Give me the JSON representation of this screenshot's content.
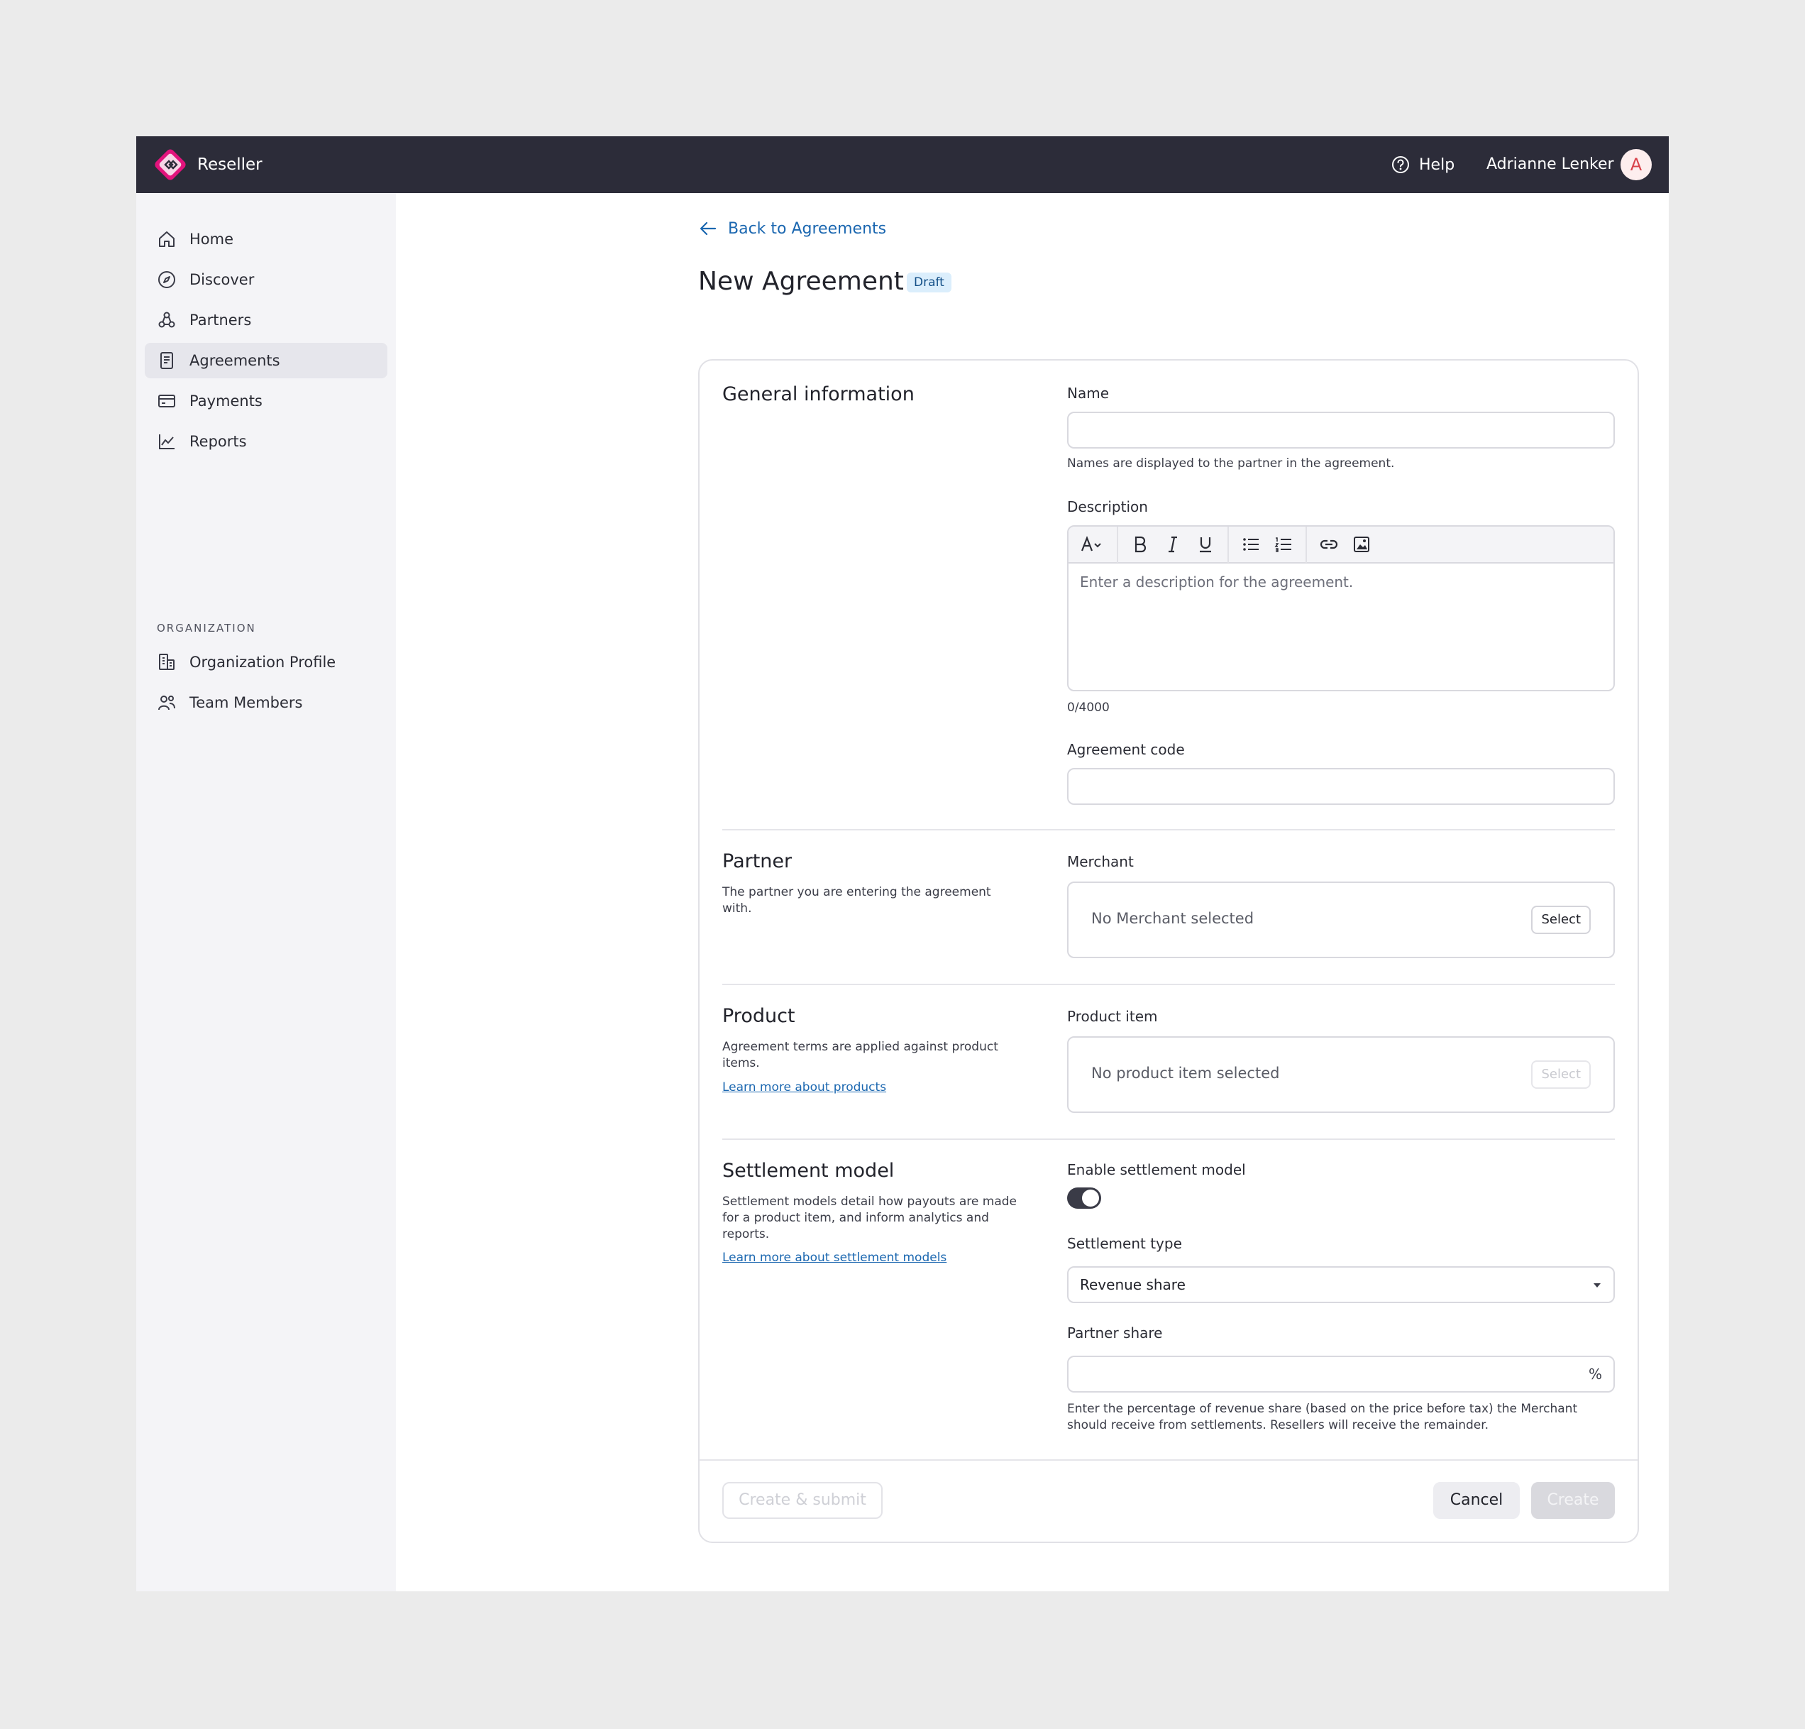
{
  "app": {
    "name": "Reseller"
  },
  "header": {
    "help_label": "Help",
    "user_name": "Adrianne Lenker",
    "avatar_initial": "A"
  },
  "sidebar": {
    "items": [
      {
        "label": "Home",
        "icon": "home-icon"
      },
      {
        "label": "Discover",
        "icon": "compass-icon"
      },
      {
        "label": "Partners",
        "icon": "partners-icon"
      },
      {
        "label": "Agreements",
        "icon": "document-icon",
        "active": true
      },
      {
        "label": "Payments",
        "icon": "credit-card-icon"
      },
      {
        "label": "Reports",
        "icon": "chart-icon"
      }
    ],
    "org_heading": "ORGANIZATION",
    "org_items": [
      {
        "label": "Organization Profile",
        "icon": "building-icon"
      },
      {
        "label": "Team Members",
        "icon": "team-icon"
      }
    ]
  },
  "page": {
    "back_label": "Back to Agreements",
    "title": "New Agreement",
    "badge": "Draft"
  },
  "general": {
    "title": "General information",
    "name_label": "Name",
    "name_value": "",
    "name_helper": "Names are displayed to the partner in the agreement.",
    "description_label": "Description",
    "description_placeholder": "Enter a description for the agreement.",
    "char_count": "0/4000",
    "code_label": "Agreement code",
    "code_value": ""
  },
  "partner": {
    "title": "Partner",
    "desc": "The partner you are entering the agreement with.",
    "merchant_label": "Merchant",
    "merchant_placeholder": "No Merchant selected",
    "select_label": "Select"
  },
  "product": {
    "title": "Product",
    "desc": "Agreement terms are applied against product items.",
    "link": "Learn more about products",
    "item_label": "Product item",
    "item_placeholder": "No product item selected",
    "select_label": "Select"
  },
  "settlement": {
    "title": "Settlement model",
    "desc": "Settlement models detail how payouts are made for a product item, and inform analytics and reports.",
    "link": "Learn more about settlement models",
    "enable_label": "Enable settlement model",
    "enabled": true,
    "type_label": "Settlement type",
    "type_value": "Revenue share",
    "share_label": "Partner share",
    "share_suffix": "%",
    "share_helper": "Enter the percentage of revenue share (based on the price before tax) the Merchant should receive from settlements. Resellers will receive the remainder."
  },
  "footer": {
    "create_submit": "Create & submit",
    "cancel": "Cancel",
    "create": "Create"
  },
  "colors": {
    "topbar": "#2c2c39",
    "link": "#1b67b0",
    "logo_pink": "#e2137c",
    "badge_bg": "#dbeefc"
  }
}
